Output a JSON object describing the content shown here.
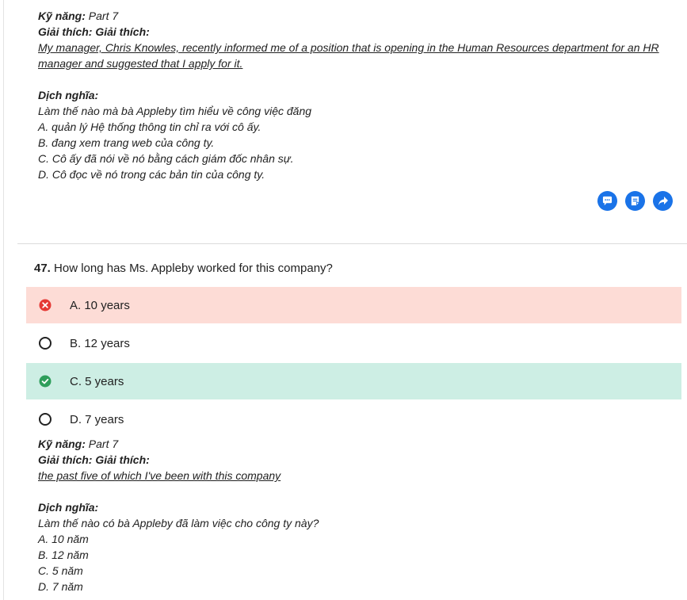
{
  "prev_explanation": {
    "skill_label": "Kỹ năng:",
    "skill_value": "Part 7",
    "explain_label": "Giải thích: Giải thích:",
    "quote": "My manager, Chris Knowles, recently informed me of a position that is opening in the Human Resources department for an HR manager and suggested that I apply for it.",
    "translation_label": "Dịch nghĩa:",
    "lines": [
      "Làm thế nào mà bà Appleby tìm hiểu về công việc đăng",
      "A. quản lý Hệ thống thông tin chỉ ra với cô ấy.",
      "B. đang xem trang web của công ty.",
      "C. Cô ấy đã nói về nó bằng cách giám đốc nhân sự.",
      "D. Cô đọc về nó trong các bản tin của công ty."
    ]
  },
  "actions": {
    "comment_icon": "comment-icon",
    "note_icon": "note-icon",
    "share_icon": "share-icon",
    "color": "#1a73e8"
  },
  "question": {
    "number": "47.",
    "text": "How long has Ms. Appleby worked for this company?",
    "options": [
      {
        "label": "A. 10 years",
        "state": "wrong"
      },
      {
        "label": "B. 12 years",
        "state": "none"
      },
      {
        "label": "C. 5 years",
        "state": "correct"
      },
      {
        "label": "D. 7 years",
        "state": "none"
      }
    ],
    "colors": {
      "wrong_bg": "#fddcd6",
      "wrong_icon": "#e53935",
      "correct_bg": "#cdeee4",
      "correct_icon": "#2e9e5b"
    }
  },
  "explanation": {
    "skill_label": "Kỹ năng:",
    "skill_value": "Part 7",
    "explain_label": "Giải thích: Giải thích:",
    "quote": "the past five of which I've been with this company",
    "translation_label": "Dịch nghĩa:",
    "lines": [
      "Làm thế nào có bà Appleby đã làm việc cho công ty này?",
      "A. 10 năm",
      "B. 12 năm",
      "C. 5 năm",
      "D. 7 năm"
    ]
  }
}
